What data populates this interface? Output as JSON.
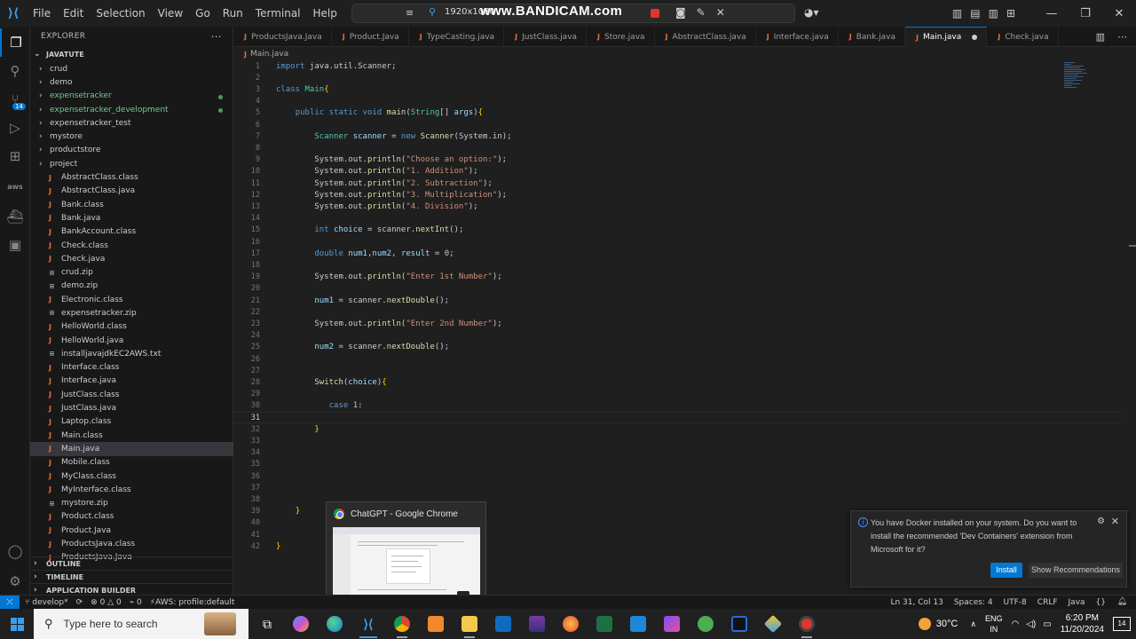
{
  "titlebar": {
    "menu": [
      "File",
      "Edit",
      "Selection",
      "View",
      "Go",
      "Run",
      "Terminal",
      "Help"
    ],
    "recording_resolution": "1920x1080",
    "watermark": "www.BANDICAM.com"
  },
  "sidebar": {
    "title": "EXPLORER",
    "workspace": "JAVATUTE",
    "items": [
      {
        "type": "folder",
        "label": "crud"
      },
      {
        "type": "folder",
        "label": "demo"
      },
      {
        "type": "folder",
        "label": "expensetracker",
        "modified": true
      },
      {
        "type": "folder",
        "label": "expensetracker_development",
        "modified": true
      },
      {
        "type": "folder",
        "label": "expensetracker_test"
      },
      {
        "type": "folder",
        "label": "mystore"
      },
      {
        "type": "folder",
        "label": "productstore"
      },
      {
        "type": "folder",
        "label": "project"
      },
      {
        "type": "java",
        "label": "AbstractClass.class"
      },
      {
        "type": "java",
        "label": "AbstractClass.java"
      },
      {
        "type": "java",
        "label": "Bank.class"
      },
      {
        "type": "java",
        "label": "Bank.java"
      },
      {
        "type": "java",
        "label": "BankAccount.class"
      },
      {
        "type": "java",
        "label": "Check.class"
      },
      {
        "type": "java",
        "label": "Check.java"
      },
      {
        "type": "plain",
        "label": "crud.zip"
      },
      {
        "type": "plain",
        "label": "demo.zip"
      },
      {
        "type": "java",
        "label": "Electronic.class"
      },
      {
        "type": "plain",
        "label": "expensetracker.zip"
      },
      {
        "type": "java",
        "label": "HelloWorld.class"
      },
      {
        "type": "java",
        "label": "HelloWorld.java"
      },
      {
        "type": "plain",
        "label": "installjavajdkEC2AWS.txt"
      },
      {
        "type": "java",
        "label": "Interface.class"
      },
      {
        "type": "java",
        "label": "Interface.java"
      },
      {
        "type": "java",
        "label": "JustClass.class"
      },
      {
        "type": "java",
        "label": "JustClass.java"
      },
      {
        "type": "java",
        "label": "Laptop.class"
      },
      {
        "type": "java",
        "label": "Main.class"
      },
      {
        "type": "java",
        "label": "Main.java",
        "selected": true
      },
      {
        "type": "java",
        "label": "Mobile.class"
      },
      {
        "type": "java",
        "label": "MyClass.class"
      },
      {
        "type": "java",
        "label": "MyInterface.class"
      },
      {
        "type": "plain",
        "label": "mystore.zip"
      },
      {
        "type": "java",
        "label": "Product.class"
      },
      {
        "type": "java",
        "label": "Product.Java"
      },
      {
        "type": "java",
        "label": "ProductsJava.class"
      },
      {
        "type": "java",
        "label": "ProductsJava.Java"
      }
    ],
    "bottom_sections": [
      "OUTLINE",
      "TIMELINE",
      "APPLICATION BUILDER"
    ]
  },
  "tabs": [
    {
      "label": "ProductsJava.Java"
    },
    {
      "label": "Product.Java"
    },
    {
      "label": "TypeCasting.java"
    },
    {
      "label": "JustClass.java"
    },
    {
      "label": "Store.java"
    },
    {
      "label": "AbstractClass.java"
    },
    {
      "label": "Interface.java"
    },
    {
      "label": "Bank.java"
    },
    {
      "label": "Main.java",
      "active": true,
      "modified": true
    },
    {
      "label": "Check.java"
    }
  ],
  "breadcrumb": "Main.java",
  "editor": {
    "current_line": 31,
    "lines": [
      [
        [
          "kw",
          "import"
        ],
        [
          "t",
          " java.util.Scanner;"
        ]
      ],
      [],
      [
        [
          "kw",
          "class"
        ],
        [
          "t",
          " "
        ],
        [
          "ty",
          "Main"
        ],
        [
          "brace",
          "{"
        ]
      ],
      [],
      [
        [
          "t",
          "    "
        ],
        [
          "kw",
          "public static void"
        ],
        [
          "t",
          " "
        ],
        [
          "fn",
          "main"
        ],
        [
          "t",
          "("
        ],
        [
          "ty",
          "String"
        ],
        [
          "t",
          "[] "
        ],
        [
          "var",
          "args"
        ],
        [
          "t",
          ")"
        ],
        [
          "brace",
          "{"
        ]
      ],
      [],
      [
        [
          "t",
          "        "
        ],
        [
          "ty",
          "Scanner"
        ],
        [
          "t",
          " "
        ],
        [
          "var",
          "scanner"
        ],
        [
          "t",
          " = "
        ],
        [
          "kw",
          "new"
        ],
        [
          "t",
          " "
        ],
        [
          "fn",
          "Scanner"
        ],
        [
          "t",
          "(System.in);"
        ]
      ],
      [],
      [
        [
          "t",
          "        System.out."
        ],
        [
          "fn",
          "println"
        ],
        [
          "t",
          "("
        ],
        [
          "str",
          "\"Choose an option:\""
        ],
        [
          "t",
          ");"
        ]
      ],
      [
        [
          "t",
          "        System.out."
        ],
        [
          "fn",
          "println"
        ],
        [
          "t",
          "("
        ],
        [
          "str",
          "\"1. Addition\""
        ],
        [
          "t",
          ");"
        ]
      ],
      [
        [
          "t",
          "        System.out."
        ],
        [
          "fn",
          "println"
        ],
        [
          "t",
          "("
        ],
        [
          "str",
          "\"2. Subtraction\""
        ],
        [
          "t",
          ");"
        ]
      ],
      [
        [
          "t",
          "        System.out."
        ],
        [
          "fn",
          "println"
        ],
        [
          "t",
          "("
        ],
        [
          "str",
          "\"3. Multiplication\""
        ],
        [
          "t",
          ");"
        ]
      ],
      [
        [
          "t",
          "        System.out."
        ],
        [
          "fn",
          "println"
        ],
        [
          "t",
          "("
        ],
        [
          "str",
          "\"4. Division\""
        ],
        [
          "t",
          ");"
        ]
      ],
      [],
      [
        [
          "t",
          "        "
        ],
        [
          "kw",
          "int"
        ],
        [
          "t",
          " "
        ],
        [
          "var",
          "choice"
        ],
        [
          "t",
          " = scanner."
        ],
        [
          "fn",
          "nextInt"
        ],
        [
          "t",
          "();"
        ]
      ],
      [],
      [
        [
          "t",
          "        "
        ],
        [
          "kw",
          "double"
        ],
        [
          "t",
          " "
        ],
        [
          "var",
          "num1"
        ],
        [
          "t",
          ","
        ],
        [
          "var",
          "num2"
        ],
        [
          "t",
          ", "
        ],
        [
          "var",
          "result"
        ],
        [
          "t",
          " = "
        ],
        [
          "num",
          "0"
        ],
        [
          "t",
          ";"
        ]
      ],
      [],
      [
        [
          "t",
          "        System.out."
        ],
        [
          "fn",
          "println"
        ],
        [
          "t",
          "("
        ],
        [
          "str",
          "\"Enter 1st Number\""
        ],
        [
          "t",
          ");"
        ]
      ],
      [],
      [
        [
          "t",
          "        "
        ],
        [
          "var",
          "num1"
        ],
        [
          "t",
          " = scanner."
        ],
        [
          "fn",
          "nextDouble"
        ],
        [
          "t",
          "();"
        ]
      ],
      [],
      [
        [
          "t",
          "        System.out."
        ],
        [
          "fn",
          "println"
        ],
        [
          "t",
          "("
        ],
        [
          "str",
          "\"Enter 2nd Number\""
        ],
        [
          "t",
          ");"
        ]
      ],
      [],
      [
        [
          "t",
          "        "
        ],
        [
          "var",
          "num2"
        ],
        [
          "t",
          " = scanner."
        ],
        [
          "fn",
          "nextDouble"
        ],
        [
          "t",
          "();"
        ]
      ],
      [],
      [],
      [
        [
          "t",
          "        "
        ],
        [
          "fn",
          "Switch"
        ],
        [
          "t",
          "("
        ],
        [
          "var",
          "choice"
        ],
        [
          "t",
          ")"
        ],
        [
          "brace",
          "{"
        ]
      ],
      [],
      [
        [
          "t",
          "           "
        ],
        [
          "kw",
          "case"
        ],
        [
          "t",
          " "
        ],
        [
          "num",
          "1"
        ],
        [
          "t",
          ":"
        ]
      ],
      [],
      [
        [
          "t",
          "        "
        ],
        [
          "brace",
          "}"
        ]
      ],
      [],
      [],
      [],
      [],
      [],
      [],
      [
        [
          "t",
          "    "
        ],
        [
          "brace",
          "}"
        ]
      ],
      [],
      [],
      [
        [
          "brace",
          "}"
        ]
      ]
    ]
  },
  "chrome_preview": {
    "title": "ChatGPT - Google Chrome"
  },
  "notification": {
    "message": "You have Docker installed on your system. Do you want to install the recommended 'Dev Containers' extension from Microsoft for it?",
    "install_label": "Install",
    "show_label": "Show Recommendations"
  },
  "statusbar": {
    "branch": "develop*",
    "errors": "0",
    "warnings": "0",
    "ports": "0",
    "aws": "AWS: profile:default",
    "position": "Ln 31, Col 13",
    "spaces": "Spaces: 4",
    "encoding": "UTF-8",
    "eol": "CRLF",
    "language": "Java"
  },
  "taskbar": {
    "search_placeholder": "Type here to search",
    "temperature": "30°C",
    "lang_top": "ENG",
    "lang_bottom": "IN",
    "time": "6:20 PM",
    "date": "11/20/2024",
    "notification_count": "14"
  },
  "colors": {
    "accent": "#0078d4",
    "java_icon": "#e76f3c",
    "modified": "#73c991"
  }
}
